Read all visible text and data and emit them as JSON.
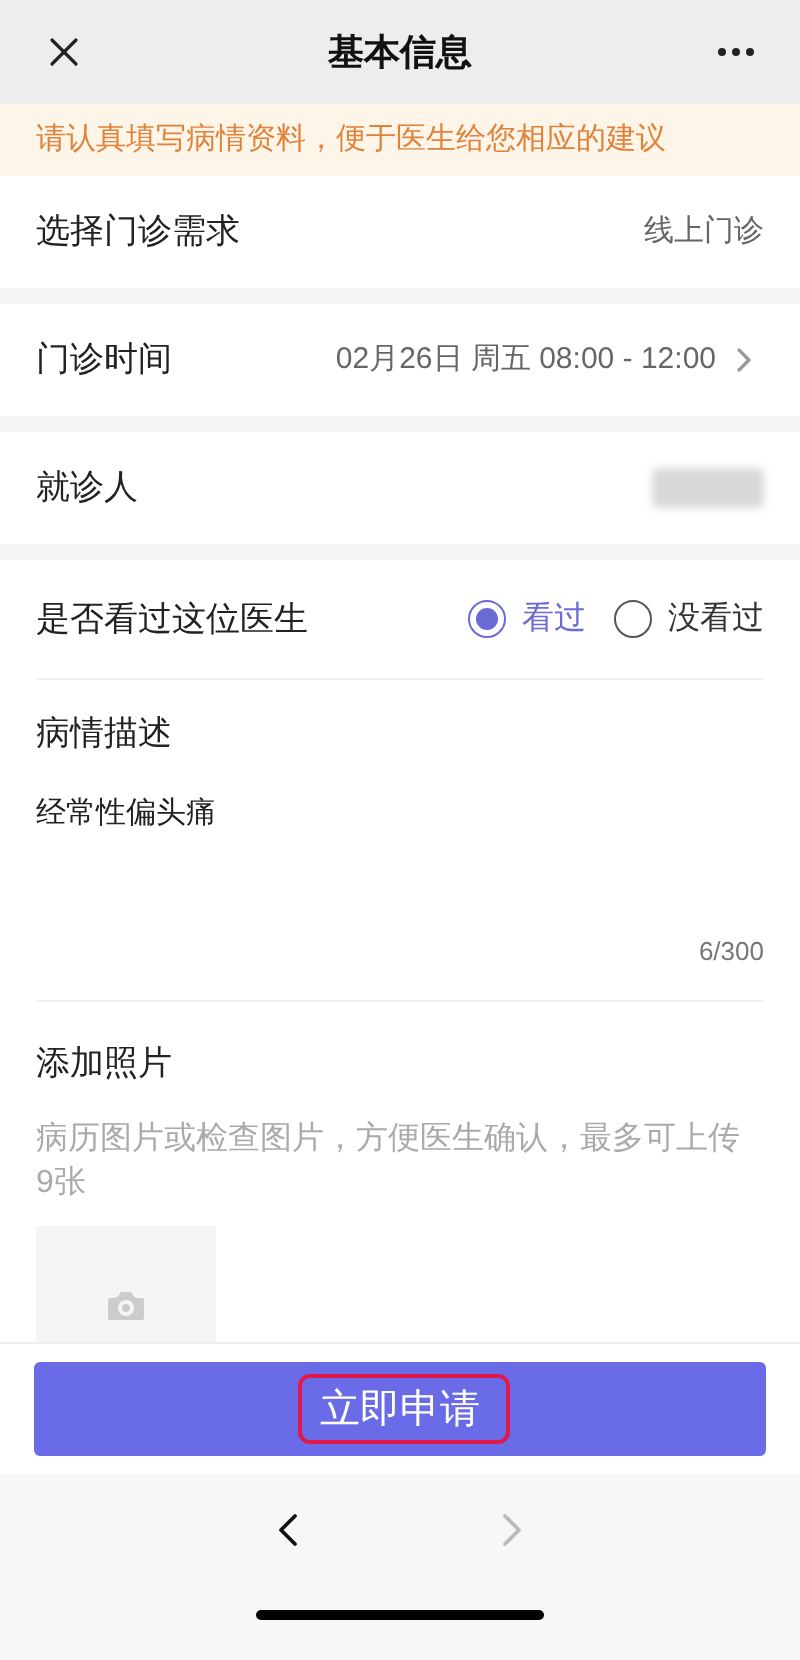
{
  "header": {
    "title": "基本信息"
  },
  "notice": "请认真填写病情资料，便于医生给您相应的建议",
  "rows": [
    {
      "label": "选择门诊需求",
      "value": "线上门诊",
      "kind": "text"
    },
    {
      "label": "门诊时间",
      "value": "02月26日 周五 08:00 - 12:00",
      "kind": "select"
    },
    {
      "label": "就诊人",
      "kind": "blurred"
    }
  ],
  "seen_question": {
    "label": "是否看过这位医生",
    "options": [
      {
        "label": "看过",
        "selected": true
      },
      {
        "label": "没看过",
        "selected": false
      }
    ]
  },
  "description": {
    "label": "病情描述",
    "value": "经常性偏头痛",
    "counter": "6/300"
  },
  "photos": {
    "label": "添加照片",
    "hint": "病历图片或检查图片，方便医生确认，最多可上传9张"
  },
  "submit": {
    "label": "立即申请",
    "highlighted": true
  }
}
